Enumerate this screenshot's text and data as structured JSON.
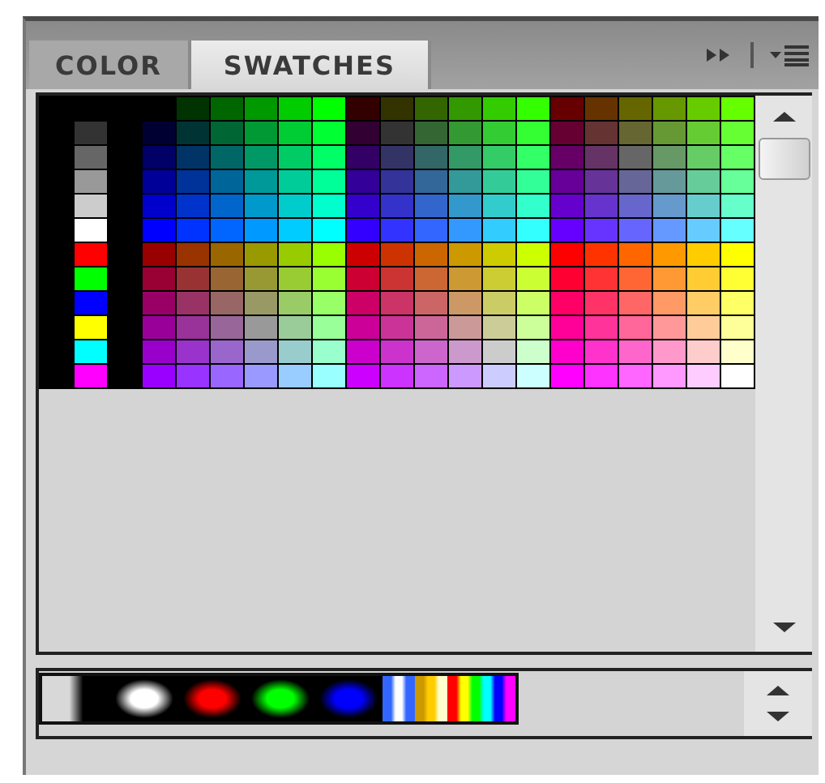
{
  "tabs": [
    {
      "label": "COLOR",
      "selected": false
    },
    {
      "label": "SWATCHES",
      "selected": true
    }
  ],
  "gray_swatches": [
    {
      "color": "#333333"
    },
    {
      "color": "#666666"
    },
    {
      "color": "#999999"
    },
    {
      "color": "#cccccc"
    },
    {
      "color": "#ffffff"
    },
    {
      "color": "#ff0000"
    },
    {
      "color": "#00ff00"
    },
    {
      "color": "#0000ff"
    },
    {
      "color": "#ffff00"
    },
    {
      "color": "#00ffff"
    },
    {
      "color": "#ff00ff"
    }
  ],
  "swatch_rows": [
    {
      "swatches": [
        {
          "color": "#003300"
        },
        {
          "color": "#006600"
        },
        {
          "color": "#009900"
        },
        {
          "color": "#00cc00"
        },
        {
          "color": "#00ff00"
        },
        {
          "color": "#330000"
        },
        {
          "color": "#333300"
        },
        {
          "color": "#336600"
        },
        {
          "color": "#339900"
        },
        {
          "color": "#33cc00"
        },
        {
          "color": "#33ff00"
        },
        {
          "color": "#660000"
        },
        {
          "color": "#663300"
        },
        {
          "color": "#666600"
        },
        {
          "color": "#669900"
        },
        {
          "color": "#66cc00"
        },
        {
          "color": "#66ff00"
        }
      ]
    },
    {
      "swatches": [
        {
          "color": "#000033"
        },
        {
          "color": "#003333"
        },
        {
          "color": "#006633"
        },
        {
          "color": "#009933"
        },
        {
          "color": "#00cc33"
        },
        {
          "color": "#00ff33"
        },
        {
          "color": "#330033"
        },
        {
          "color": "#333333"
        },
        {
          "color": "#336633"
        },
        {
          "color": "#339933"
        },
        {
          "color": "#33cc33"
        },
        {
          "color": "#33ff33"
        },
        {
          "color": "#660033"
        },
        {
          "color": "#663333"
        },
        {
          "color": "#666633"
        },
        {
          "color": "#669933"
        },
        {
          "color": "#66cc33"
        },
        {
          "color": "#66ff33"
        }
      ]
    },
    {
      "swatches": [
        {
          "color": "#000066"
        },
        {
          "color": "#003366"
        },
        {
          "color": "#006666"
        },
        {
          "color": "#009966"
        },
        {
          "color": "#00cc66"
        },
        {
          "color": "#00ff66"
        },
        {
          "color": "#330066"
        },
        {
          "color": "#333366"
        },
        {
          "color": "#336666"
        },
        {
          "color": "#339966"
        },
        {
          "color": "#33cc66"
        },
        {
          "color": "#33ff66"
        },
        {
          "color": "#660066"
        },
        {
          "color": "#663366"
        },
        {
          "color": "#666666"
        },
        {
          "color": "#669966"
        },
        {
          "color": "#66cc66"
        },
        {
          "color": "#66ff66"
        }
      ]
    },
    {
      "swatches": [
        {
          "color": "#000099"
        },
        {
          "color": "#003399"
        },
        {
          "color": "#006699"
        },
        {
          "color": "#009999"
        },
        {
          "color": "#00cc99"
        },
        {
          "color": "#00ff99"
        },
        {
          "color": "#330099"
        },
        {
          "color": "#333399"
        },
        {
          "color": "#336699"
        },
        {
          "color": "#339999"
        },
        {
          "color": "#33cc99"
        },
        {
          "color": "#33ff99"
        },
        {
          "color": "#660099"
        },
        {
          "color": "#663399"
        },
        {
          "color": "#666699"
        },
        {
          "color": "#669999"
        },
        {
          "color": "#66cc99"
        },
        {
          "color": "#66ff99"
        }
      ]
    },
    {
      "swatches": [
        {
          "color": "#0000cc"
        },
        {
          "color": "#0033cc"
        },
        {
          "color": "#0066cc"
        },
        {
          "color": "#0099cc"
        },
        {
          "color": "#00cccc"
        },
        {
          "color": "#00ffcc"
        },
        {
          "color": "#3300cc"
        },
        {
          "color": "#3333cc"
        },
        {
          "color": "#3366cc"
        },
        {
          "color": "#3399cc"
        },
        {
          "color": "#33cccc"
        },
        {
          "color": "#33ffcc"
        },
        {
          "color": "#6600cc"
        },
        {
          "color": "#6633cc"
        },
        {
          "color": "#6666cc"
        },
        {
          "color": "#6699cc"
        },
        {
          "color": "#66cccc"
        },
        {
          "color": "#66ffcc"
        }
      ]
    },
    {
      "swatches": [
        {
          "color": "#0000ff"
        },
        {
          "color": "#0033ff"
        },
        {
          "color": "#0066ff"
        },
        {
          "color": "#0099ff"
        },
        {
          "color": "#00ccff"
        },
        {
          "color": "#00ffff"
        },
        {
          "color": "#3300ff"
        },
        {
          "color": "#3333ff"
        },
        {
          "color": "#3366ff"
        },
        {
          "color": "#3399ff"
        },
        {
          "color": "#33ccff"
        },
        {
          "color": "#33ffff"
        },
        {
          "color": "#6600ff"
        },
        {
          "color": "#6633ff"
        },
        {
          "color": "#6666ff"
        },
        {
          "color": "#6699ff"
        },
        {
          "color": "#66ccff"
        },
        {
          "color": "#66ffff"
        }
      ]
    },
    {
      "swatches": [
        {
          "color": "#990000"
        },
        {
          "color": "#993300"
        },
        {
          "color": "#996600"
        },
        {
          "color": "#999900"
        },
        {
          "color": "#99cc00"
        },
        {
          "color": "#99ff00"
        },
        {
          "color": "#cc0000"
        },
        {
          "color": "#cc3300"
        },
        {
          "color": "#cc6600"
        },
        {
          "color": "#cc9900"
        },
        {
          "color": "#cccc00"
        },
        {
          "color": "#ccff00"
        },
        {
          "color": "#ff0000"
        },
        {
          "color": "#ff3300"
        },
        {
          "color": "#ff6600"
        },
        {
          "color": "#ff9900"
        },
        {
          "color": "#ffcc00"
        },
        {
          "color": "#ffff00"
        }
      ]
    },
    {
      "swatches": [
        {
          "color": "#990033"
        },
        {
          "color": "#993333"
        },
        {
          "color": "#996633"
        },
        {
          "color": "#999933"
        },
        {
          "color": "#99cc33"
        },
        {
          "color": "#99ff33"
        },
        {
          "color": "#cc0033"
        },
        {
          "color": "#cc3333"
        },
        {
          "color": "#cc6633"
        },
        {
          "color": "#cc9933"
        },
        {
          "color": "#cccc33"
        },
        {
          "color": "#ccff33"
        },
        {
          "color": "#ff0033"
        },
        {
          "color": "#ff3333"
        },
        {
          "color": "#ff6633"
        },
        {
          "color": "#ff9933"
        },
        {
          "color": "#ffcc33"
        },
        {
          "color": "#ffff33"
        }
      ]
    },
    {
      "swatches": [
        {
          "color": "#990066"
        },
        {
          "color": "#993366"
        },
        {
          "color": "#996666"
        },
        {
          "color": "#999966"
        },
        {
          "color": "#99cc66"
        },
        {
          "color": "#99ff66"
        },
        {
          "color": "#cc0066"
        },
        {
          "color": "#cc3366"
        },
        {
          "color": "#cc6666"
        },
        {
          "color": "#cc9966"
        },
        {
          "color": "#cccc66"
        },
        {
          "color": "#ccff66"
        },
        {
          "color": "#ff0066"
        },
        {
          "color": "#ff3366"
        },
        {
          "color": "#ff6666"
        },
        {
          "color": "#ff9966"
        },
        {
          "color": "#ffcc66"
        },
        {
          "color": "#ffff66"
        }
      ]
    },
    {
      "swatches": [
        {
          "color": "#990099"
        },
        {
          "color": "#993399"
        },
        {
          "color": "#996699"
        },
        {
          "color": "#999999"
        },
        {
          "color": "#99cc99"
        },
        {
          "color": "#99ff99"
        },
        {
          "color": "#cc0099"
        },
        {
          "color": "#cc3399"
        },
        {
          "color": "#cc6699"
        },
        {
          "color": "#cc9999"
        },
        {
          "color": "#cccc99"
        },
        {
          "color": "#ccff99"
        },
        {
          "color": "#ff0099"
        },
        {
          "color": "#ff3399"
        },
        {
          "color": "#ff6699"
        },
        {
          "color": "#ff9999"
        },
        {
          "color": "#ffcc99"
        },
        {
          "color": "#ffff99"
        }
      ]
    },
    {
      "swatches": [
        {
          "color": "#9900cc"
        },
        {
          "color": "#9933cc"
        },
        {
          "color": "#9966cc"
        },
        {
          "color": "#9999cc"
        },
        {
          "color": "#99cccc"
        },
        {
          "color": "#99ffcc"
        },
        {
          "color": "#cc00cc"
        },
        {
          "color": "#cc33cc"
        },
        {
          "color": "#cc66cc"
        },
        {
          "color": "#cc99cc"
        },
        {
          "color": "#cccccc"
        },
        {
          "color": "#ccffcc"
        },
        {
          "color": "#ff00cc"
        },
        {
          "color": "#ff33cc"
        },
        {
          "color": "#ff66cc"
        },
        {
          "color": "#ff99cc"
        },
        {
          "color": "#ffcccc"
        },
        {
          "color": "#ffffcc"
        }
      ]
    },
    {
      "swatches": [
        {
          "color": "#9900ff"
        },
        {
          "color": "#9933ff"
        },
        {
          "color": "#9966ff"
        },
        {
          "color": "#9999ff"
        },
        {
          "color": "#99ccff"
        },
        {
          "color": "#99ffff"
        },
        {
          "color": "#cc00ff"
        },
        {
          "color": "#cc33ff"
        },
        {
          "color": "#cc66ff"
        },
        {
          "color": "#cc99ff"
        },
        {
          "color": "#ccccff"
        },
        {
          "color": "#ccffff"
        },
        {
          "color": "#ff00ff"
        },
        {
          "color": "#ff33ff"
        },
        {
          "color": "#ff66ff"
        },
        {
          "color": "#ff99ff"
        },
        {
          "color": "#ffccff"
        },
        {
          "color": "#ffffff"
        }
      ]
    }
  ],
  "gradients": [
    {
      "kind": "linear",
      "stops": [
        {
          "color": "#d8d8d8"
        },
        {
          "color": "#000000"
        }
      ]
    },
    {
      "kind": "radial",
      "stops": [
        {
          "color": "#ffffff"
        },
        {
          "color": "#000000"
        }
      ]
    },
    {
      "kind": "radial",
      "stops": [
        {
          "color": "#ff0000"
        },
        {
          "color": "#000000"
        }
      ]
    },
    {
      "kind": "radial",
      "stops": [
        {
          "color": "#00ff00"
        },
        {
          "color": "#000000"
        }
      ]
    },
    {
      "kind": "radial",
      "stops": [
        {
          "color": "#0000ff"
        },
        {
          "color": "#000000"
        }
      ]
    },
    {
      "kind": "narrow",
      "stops": [
        {
          "color": "#3366ff"
        },
        {
          "color": "#ffffff"
        },
        {
          "color": "#3366ff"
        }
      ]
    },
    {
      "kind": "narrow",
      "stops": [
        {
          "color": "#cc9900"
        },
        {
          "color": "#ffcc00"
        },
        {
          "color": "#ffffcc"
        }
      ]
    },
    {
      "kind": "linear",
      "stops": [
        {
          "color": "#ff0000"
        },
        {
          "color": "#ffff00"
        },
        {
          "color": "#00ff00"
        },
        {
          "color": "#00ffff"
        },
        {
          "color": "#0000ff"
        },
        {
          "color": "#ff00ff"
        }
      ]
    }
  ]
}
